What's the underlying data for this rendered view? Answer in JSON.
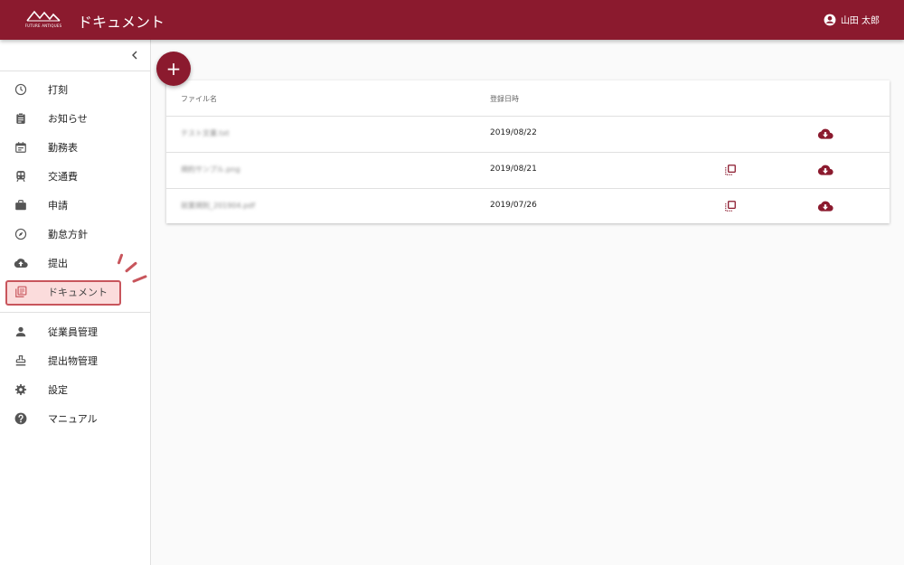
{
  "header": {
    "logo_text": "FUTURE ANTIQUES",
    "title": "ドキュメント",
    "user_name": "山田 太郎"
  },
  "sidebar": {
    "items": [
      {
        "label": "打刻",
        "icon": "clock-icon"
      },
      {
        "label": "お知らせ",
        "icon": "clipboard-icon"
      },
      {
        "label": "勤務表",
        "icon": "calendar-icon"
      },
      {
        "label": "交通費",
        "icon": "train-icon"
      },
      {
        "label": "申請",
        "icon": "briefcase-icon"
      },
      {
        "label": "勤怠方針",
        "icon": "compass-icon"
      },
      {
        "label": "提出",
        "icon": "cloud-upload-icon"
      },
      {
        "label": "ドキュメント",
        "icon": "library-books-icon"
      }
    ],
    "admin_items": [
      {
        "label": "従業員管理",
        "icon": "person-icon"
      },
      {
        "label": "提出物管理",
        "icon": "stamp-icon"
      },
      {
        "label": "設定",
        "icon": "gear-icon"
      },
      {
        "label": "マニュアル",
        "icon": "help-icon"
      }
    ]
  },
  "table": {
    "headers": {
      "filename": "ファイル名",
      "date": "登録日時"
    },
    "rows": [
      {
        "filename": "テスト文書.txt",
        "date": "2019/08/22",
        "has_copy": false
      },
      {
        "filename": "規約サンプル.png",
        "date": "2019/08/21",
        "has_copy": true
      },
      {
        "filename": "就業規則_201904.pdf",
        "date": "2019/07/26",
        "has_copy": true
      }
    ]
  },
  "fab": {
    "label": "+"
  },
  "colors": {
    "brand": "#8b1a2e",
    "highlight": "#c8555c"
  }
}
